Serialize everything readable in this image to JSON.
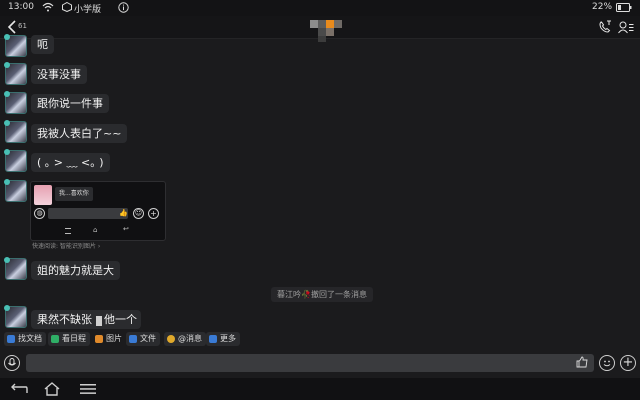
{
  "status": {
    "time": "13:00",
    "app_name": "小学版",
    "battery": "22%"
  },
  "header": {
    "back_badge": "61"
  },
  "messages": [
    {
      "text": "呃"
    },
    {
      "text": "没事没事"
    },
    {
      "text": "跟你说一件事"
    },
    {
      "text": "我被人表白了~~"
    },
    {
      "text": "( ｡ > ﹏ <｡ )"
    },
    {
      "text": "姐的魅力就是大"
    },
    {
      "text": "果然不缺张"
    },
    {
      "text": "他一个"
    }
  ],
  "screenshot_card": {
    "preview_text": "我...喜欢你",
    "caption": "快速阅读: 智能识别图片 ›"
  },
  "recall_notice": "暮江吟🥀撤回了一条消息",
  "toolbar": [
    {
      "label": "找文档",
      "color": "#3a7bd5"
    },
    {
      "label": "看日程",
      "color": "#2fae66"
    },
    {
      "label": "图片",
      "color": "#e08a2b"
    },
    {
      "label": "文件",
      "color": "#3a7bd5"
    },
    {
      "label": "@消息",
      "color": "#e0a92b"
    },
    {
      "label": "更多",
      "color": "#3a7bd5"
    }
  ],
  "colors": {
    "background": "#1b1b1d",
    "bubble": "#2a2b2e",
    "input": "#3a3b3e"
  }
}
